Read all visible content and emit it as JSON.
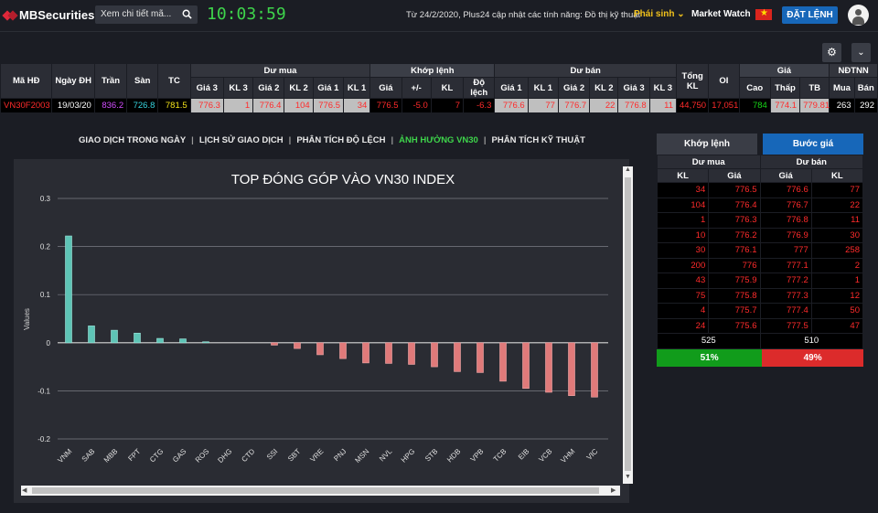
{
  "header": {
    "brand": "MBSecurities",
    "search_placeholder": "Xem chi tiết mã...",
    "clock": "10:03:59",
    "notice": "Từ 24/2/2020, Plus24 cập nhật các tính năng: Đồ thị kỹ thuật",
    "phai_sinh": "Phái sinh",
    "market_watch": "Market Watch",
    "order_button": "ĐẶT LỆNH"
  },
  "quote_table": {
    "headers": {
      "ma_hd": "Mã HĐ",
      "ngay_dh": "Ngày ĐH",
      "tran": "Trần",
      "san": "Sàn",
      "tc": "TC",
      "du_mua": "Dư mua",
      "khop_lenh": "Khớp lệnh",
      "du_ban": "Dư bán",
      "tong_kl": "Tổng KL",
      "oi": "OI",
      "gia": "Giá",
      "ndtnn": "NĐTNN",
      "gia3": "Giá 3",
      "kl3": "KL 3",
      "gia2": "Giá 2",
      "kl2": "KL 2",
      "gia1": "Giá 1",
      "kl1": "KL 1",
      "k_gia": "Giá",
      "k_pm": "+/-",
      "k_kl": "KL",
      "k_dl": "Độ lệch",
      "cao": "Cao",
      "thap": "Thấp",
      "tb": "TB",
      "mua": "Mua",
      "ban": "Bán"
    },
    "row": {
      "ma_hd": "VN30F2003",
      "ngay_dh": "19/03/20",
      "tran": "836.2",
      "san": "726.8",
      "tc": "781.5",
      "mua_gia3": "776.3",
      "mua_kl3": "1",
      "mua_gia2": "776.4",
      "mua_kl2": "104",
      "mua_gia1": "776.5",
      "mua_kl1": "34",
      "khop_gia": "776.5",
      "khop_pm": "-5.0",
      "khop_kl": "7",
      "khop_dl": "-6.3",
      "ban_gia1": "776.6",
      "ban_kl1": "77",
      "ban_gia2": "776.7",
      "ban_kl2": "22",
      "ban_gia3": "776.8",
      "ban_kl3": "11",
      "tong_kl": "44,750",
      "oi": "17,051",
      "cao": "784",
      "thap": "774.1",
      "tb": "779.81",
      "mua": "263",
      "ban": "292"
    }
  },
  "tabs": [
    "GIAO DỊCH TRONG NGÀY",
    "LỊCH SỬ GIAO DỊCH",
    "PHÂN TÍCH ĐỘ LỆCH",
    "ẢNH HƯỞNG VN30",
    "PHÂN TÍCH KỸ THUẬT"
  ],
  "active_tab": "ẢNH HƯỞNG VN30",
  "chart_data": {
    "type": "bar",
    "title": "TOP ĐÓNG GÓP VÀO VN30 INDEX",
    "ylabel": "Values",
    "ylim": [
      -0.2,
      0.3
    ],
    "yticks": [
      "0.3",
      "0.2",
      "0.1",
      "0",
      "-0.1",
      "-0.2"
    ],
    "categories": [
      "VNM",
      "SAB",
      "MBB",
      "FPT",
      "CTG",
      "GAS",
      "ROS",
      "DHG",
      "CTD",
      "SSI",
      "SBT",
      "VRE",
      "PNJ",
      "MSN",
      "NVL",
      "HPG",
      "STB",
      "HDB",
      "VPB",
      "TCB",
      "EIB",
      "VCB",
      "VHM",
      "VIC"
    ],
    "values": [
      0.222,
      0.035,
      0.026,
      0.02,
      0.009,
      0.008,
      0.002,
      0,
      0,
      -0.005,
      -0.012,
      -0.025,
      -0.033,
      -0.042,
      -0.043,
      -0.045,
      -0.05,
      -0.06,
      -0.062,
      -0.08,
      -0.095,
      -0.103,
      -0.11,
      -0.113
    ],
    "positive_color": "#5ec4b6",
    "negative_color": "#e07a7a"
  },
  "order_book": {
    "tab_khop": "Khớp lệnh",
    "tab_buoc": "Bước giá",
    "du_mua": "Dư mua",
    "du_ban": "Dư bán",
    "kl": "KL",
    "gia": "Giá",
    "rows": [
      [
        "34",
        "776.5",
        "776.6",
        "77"
      ],
      [
        "104",
        "776.4",
        "776.7",
        "22"
      ],
      [
        "1",
        "776.3",
        "776.8",
        "11"
      ],
      [
        "10",
        "776.2",
        "776.9",
        "30"
      ],
      [
        "30",
        "776.1",
        "777",
        "258"
      ],
      [
        "200",
        "776",
        "777.1",
        "2"
      ],
      [
        "43",
        "775.9",
        "777.2",
        "1"
      ],
      [
        "75",
        "775.8",
        "777.3",
        "12"
      ],
      [
        "4",
        "775.7",
        "777.4",
        "50"
      ],
      [
        "24",
        "775.6",
        "777.5",
        "47"
      ]
    ],
    "total_buy": "525",
    "total_sell": "510",
    "pct_buy": "51%",
    "pct_sell": "49%",
    "pct_buy_value": 51,
    "buy_color": "#119c1b",
    "sell_color": "#dc2b2b"
  }
}
